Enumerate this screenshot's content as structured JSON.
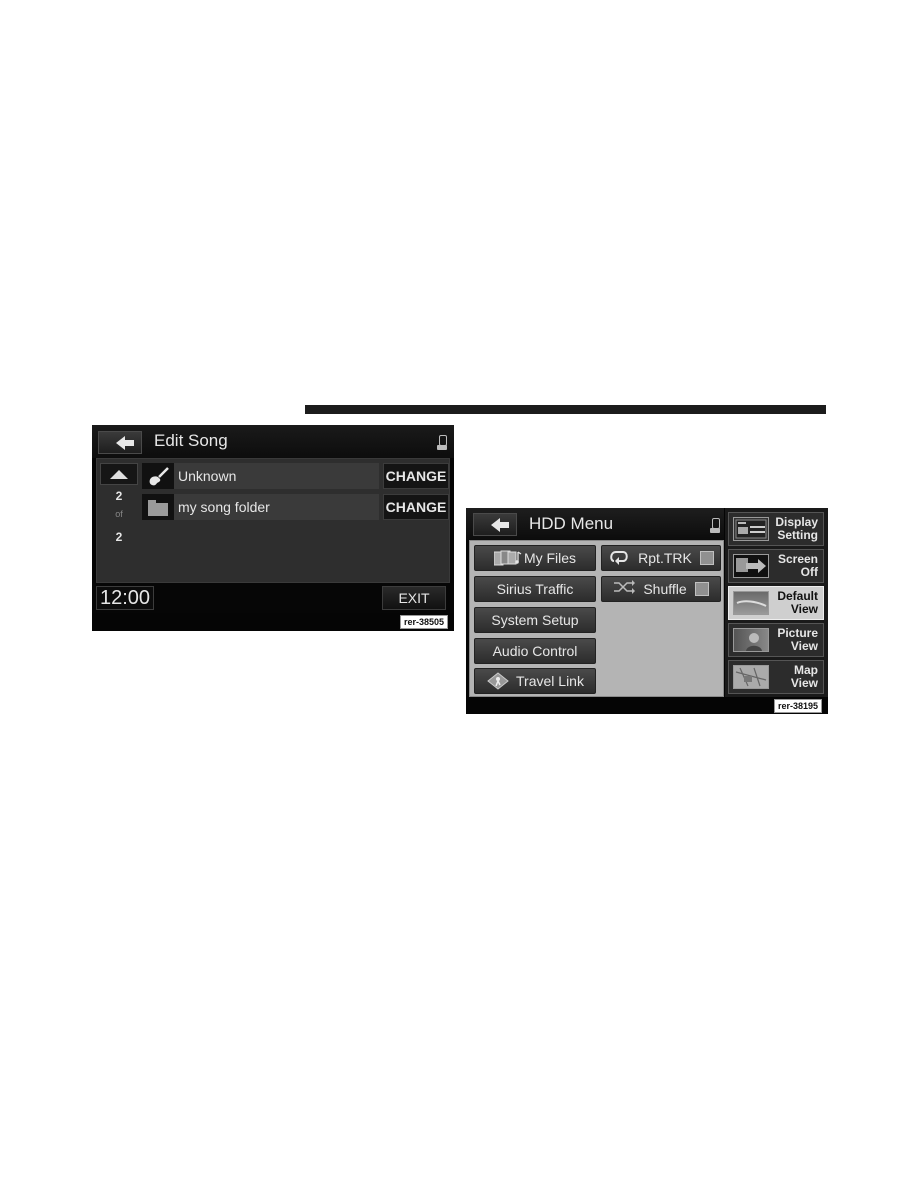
{
  "edit_song_screen": {
    "back_icon": "arrow-left-icon",
    "title": "Edit Song",
    "seat_icon": "seat-icon",
    "pager": {
      "current": "2",
      "of_label": "of",
      "total": "2"
    },
    "rows": [
      {
        "icon": "guitar-icon",
        "label": "Unknown",
        "action": "CHANGE"
      },
      {
        "icon": "folder-icon",
        "label": "my song folder",
        "action": "CHANGE"
      }
    ],
    "clock": "12:00",
    "exit_label": "EXIT",
    "ref_label": "rer-38505"
  },
  "hdd_menu_screen": {
    "back_icon": "arrow-left-icon",
    "title": "HDD Menu",
    "seat_icon": "seat-icon",
    "left_buttons": [
      {
        "label": "My Files",
        "icon": "media-files-icon"
      },
      {
        "label": "Sirius Traffic"
      },
      {
        "label": "System Setup"
      },
      {
        "label": "Audio Control"
      },
      {
        "label": "Travel Link",
        "icon": "travel-link-icon"
      }
    ],
    "toggles": [
      {
        "label": "Rpt.TRK",
        "icon": "repeat-icon",
        "checked": false
      },
      {
        "label": "Shuffle",
        "icon": "shuffle-icon",
        "checked": false
      }
    ],
    "side_buttons": [
      {
        "line1": "Display",
        "line2": "Setting",
        "active": false
      },
      {
        "line1": "Screen",
        "line2": "Off",
        "active": false
      },
      {
        "line1": "Default",
        "line2": "View",
        "active": true
      },
      {
        "line1": "Picture",
        "line2": "View",
        "active": false
      },
      {
        "line1": "Map",
        "line2": "View",
        "active": false
      }
    ],
    "ref_label": "rer-38195"
  }
}
